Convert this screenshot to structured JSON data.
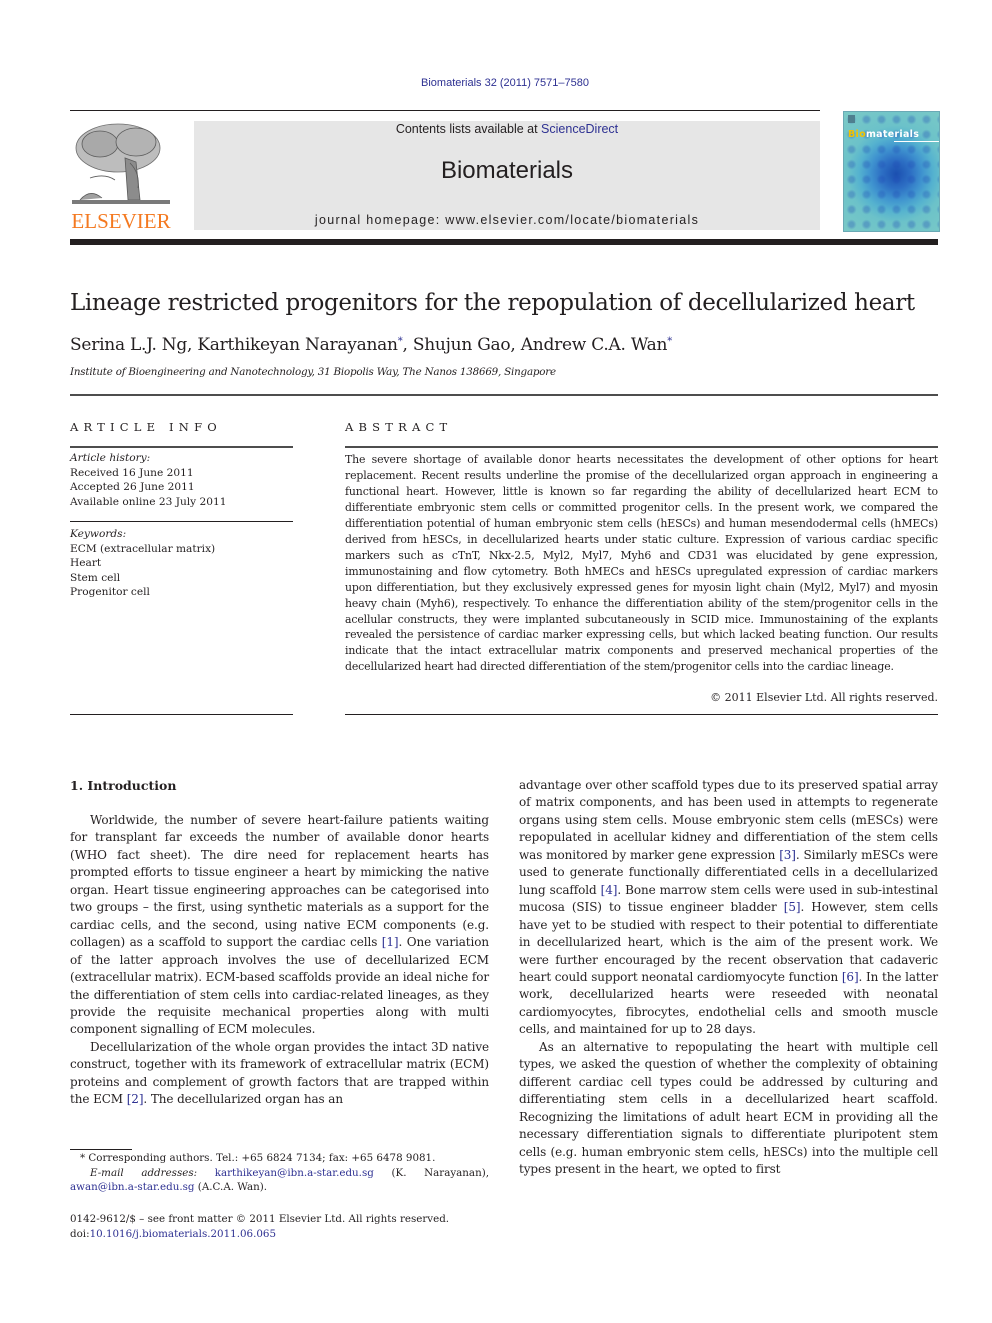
{
  "header": {
    "journal_reference": "Biomaterials 32 (2011) 7571–7580",
    "publisher_logo_text": "ELSEVIER",
    "contents_prefix": "Contents lists available at ",
    "contents_link": "ScienceDirect",
    "journal_title": "Biomaterials",
    "homepage": "journal homepage: www.elsevier.com/locate/biomaterials",
    "cover": {
      "title_highlight": "Bio",
      "title_rest": "materials"
    },
    "colors": {
      "link": "#2e3192",
      "elsevier_orange": "#f47920",
      "banner_bg": "#e6e6e6"
    }
  },
  "article": {
    "title": "Lineage restricted progenitors for the repopulation of decellularized heart",
    "authors": [
      {
        "name": "Serina L.J. Ng",
        "corresponding": false,
        "sep": ", "
      },
      {
        "name": "Karthikeyan Narayanan",
        "corresponding": true,
        "sep": ", "
      },
      {
        "name": "Shujun Gao",
        "corresponding": false,
        "sep": ", "
      },
      {
        "name": "Andrew C.A. Wan",
        "corresponding": true,
        "sep": ""
      }
    ],
    "corresponding_mark": "*",
    "affiliation": "Institute of Bioengineering and Nanotechnology, 31 Biopolis Way, The Nanos 138669, Singapore"
  },
  "article_info": {
    "heading": "ARTICLE INFO",
    "history_label": "Article history:",
    "history": [
      "Received 16 June 2011",
      "Accepted 26 June 2011",
      "Available online 23 July 2011"
    ],
    "keywords_label": "Keywords:",
    "keywords": [
      "ECM (extracellular matrix)",
      "Heart",
      "Stem cell",
      "Progenitor cell"
    ]
  },
  "abstract": {
    "heading": "ABSTRACT",
    "text": "The severe shortage of available donor hearts necessitates the development of other options for heart replacement. Recent results underline the promise of the decellularized organ approach in engineering a functional heart. However, little is known so far regarding the ability of decellularized heart ECM to differentiate embryonic stem cells or committed progenitor cells. In the present work, we compared the differentiation potential of human embryonic stem cells (hESCs) and human mesendodermal cells (hMECs) derived from hESCs, in decellularized hearts under static culture. Expression of various cardiac specific markers such as cTnT, Nkx-2.5, Myl2, Myl7, Myh6 and CD31 was elucidated by gene expression, immunostaining and flow cytometry. Both hMECs and hESCs upregulated expression of cardiac markers upon differentiation, but they exclusively expressed genes for myosin light chain (Myl2, Myl7) and myosin heavy chain (Myh6), respectively. To enhance the differentiation ability of the stem/progenitor cells in the acellular constructs, they were implanted subcutaneously in SCID mice. Immunostaining of the explants revealed the persistence of cardiac marker expressing cells, but which lacked beating function. Our results indicate that the intact extracellular matrix components and preserved mechanical properties of the decellularized heart had directed differentiation of the stem/progenitor cells into the cardiac lineage.",
    "copyright": "© 2011 Elsevier Ltd. All rights reserved."
  },
  "introduction": {
    "heading": "1.  Introduction",
    "left_paragraphs": [
      [
        {
          "t": "Worldwide, the number of severe heart-failure patients waiting for transplant far exceeds the number of available donor hearts (WHO fact sheet). The dire need for replacement hearts has prompted efforts to tissue engineer a heart by mimicking the native organ. Heart tissue engineering approaches can be categorised into two groups – the first, using synthetic materials as a support for the cardiac cells, and the second, using native ECM components (e.g. collagen) as a scaffold to support the cardiac cells "
        },
        {
          "ref": "[1]"
        },
        {
          "t": ". One variation of the latter approach involves the use of decellularized ECM (extracellular matrix). ECM-based scaffolds provide an ideal niche for the differentiation of stem cells into cardiac-related lineages, as they provide the requisite mechanical properties along with multi component signalling of ECM molecules."
        }
      ],
      [
        {
          "t": "Decellularization of the whole organ provides the intact 3D native construct, together with its framework of extracellular matrix (ECM) proteins and complement of growth factors that are trapped within the ECM "
        },
        {
          "ref": "[2]"
        },
        {
          "t": ". The decellularized organ has an"
        }
      ]
    ],
    "right_paragraphs": [
      [
        {
          "t": "advantage over other scaffold types due to its preserved spatial array of matrix components, and has been used in attempts to regenerate organs using stem cells. Mouse embryonic stem cells (mESCs) were repopulated in acellular kidney and differentiation of the stem cells was monitored by marker gene expression "
        },
        {
          "ref": "[3]"
        },
        {
          "t": ". Similarly mESCs were used to generate functionally differentiated cells in a decellularized lung scaffold "
        },
        {
          "ref": "[4]"
        },
        {
          "t": ". Bone marrow stem cells were used in sub-intestinal mucosa (SIS) to tissue engineer bladder "
        },
        {
          "ref": "[5]"
        },
        {
          "t": ". However, stem cells have yet to be studied with respect to their potential to differentiate in decellularized heart, which is the aim of the present work. We were further encouraged by the recent observation that cadaveric heart could support neonatal cardiomyocyte function "
        },
        {
          "ref": "[6]"
        },
        {
          "t": ". In the latter work, decellularized hearts were reseeded with neonatal cardiomyocytes, fibrocytes, endothelial cells and smooth muscle cells, and maintained for up to 28 days."
        }
      ],
      [
        {
          "t": "As an alternative to repopulating the heart with multiple cell types, we asked the question of whether the complexity of obtaining different cardiac cell types could be addressed by culturing and differentiating stem cells in a decellularized heart scaffold. Recognizing the limitations of adult heart ECM in providing all the necessary differentiation signals to differentiate pluripotent stem cells (e.g. human embryonic stem cells, hESCs) into the multiple cell types present in the heart, we opted to first"
        }
      ]
    ]
  },
  "footnotes": {
    "corresponding": "* Corresponding authors. Tel.: +65 6824 7134; fax: +65 6478 9081.",
    "email_label": "E-mail addresses: ",
    "email1": "karthikeyan@ibn.a-star.edu.sg",
    "email1_owner": " (K. Narayanan), ",
    "email2": "awan@ibn.a-star.edu.sg",
    "email2_owner": " (A.C.A. Wan).",
    "issn_line": "0142-9612/$ – see front matter © 2011 Elsevier Ltd. All rights reserved.",
    "doi_prefix": "doi:",
    "doi": "10.1016/j.biomaterials.2011.06.065"
  }
}
